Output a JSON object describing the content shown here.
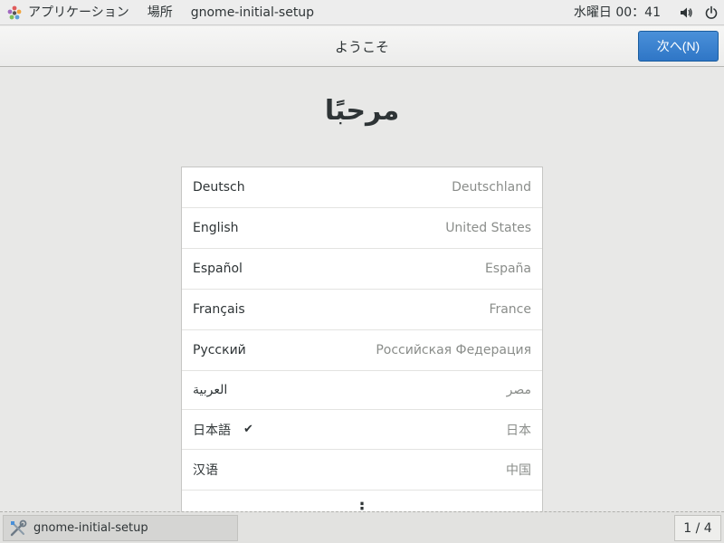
{
  "topbar": {
    "applications_label": "アプリケーション",
    "places_label": "場所",
    "app_name": "gnome-initial-setup",
    "clock": "水曜日 00：41",
    "icons": [
      "gnome-foot-icon",
      "volume-icon",
      "power-icon"
    ]
  },
  "header": {
    "title": "ようこそ",
    "next_label": "次へ(N)"
  },
  "welcome_text": "مرحبًا",
  "languages": [
    {
      "name": "Deutsch",
      "country": "Deutschland",
      "selected": false
    },
    {
      "name": "English",
      "country": "United States",
      "selected": false
    },
    {
      "name": "Español",
      "country": "España",
      "selected": false
    },
    {
      "name": "Français",
      "country": "France",
      "selected": false
    },
    {
      "name": "Русский",
      "country": "Российская Федерация",
      "selected": false
    },
    {
      "name": "العربية",
      "country": "مصر",
      "selected": false
    },
    {
      "name": "日本語",
      "country": "日本",
      "selected": true
    },
    {
      "name": "汉语",
      "country": "中国",
      "selected": false
    }
  ],
  "more_icon": "⋮",
  "taskbar": {
    "task_label": "gnome-initial-setup",
    "workspace": "1 / 4"
  },
  "colors": {
    "accent": "#3584d2",
    "background": "#e8e8e7"
  }
}
